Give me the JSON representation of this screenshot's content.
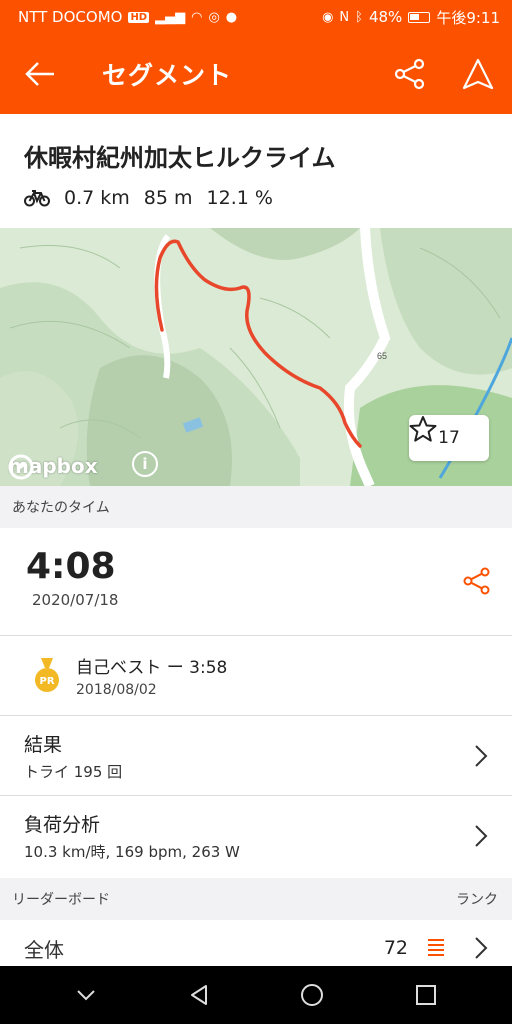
{
  "status_bar": {
    "carrier": "NTT DOCOMO",
    "carrier_badge": "HD",
    "battery": "48%",
    "time": "午後9:11"
  },
  "app_bar": {
    "title": "セグメント",
    "icons": [
      "back-arrow-icon",
      "share-icon",
      "navigate-icon"
    ]
  },
  "segment": {
    "name": "休暇村紀州加太ヒルクライム",
    "distance": "0.7 km",
    "elevation": "85 m",
    "grade": "12.1 %"
  },
  "map": {
    "provider": "mapbox",
    "road_label": "65",
    "star_count": "17",
    "route_color": "#e8472b"
  },
  "your_time": {
    "section_label": "あなたのタイム",
    "time": "4:08",
    "date": "2020/07/18"
  },
  "personal_best": {
    "badge": "PR",
    "label": "自己ベスト ー 3:58",
    "date": "2018/08/02"
  },
  "results": {
    "title": "結果",
    "subtitle": "トライ 195 回"
  },
  "effort_analysis": {
    "title": "負荷分析",
    "subtitle": "10.3 km/時, 169 bpm, 263 W"
  },
  "leaderboard": {
    "section_label": "リーダーボード",
    "rank_label": "ランク",
    "overall_label": "全体",
    "overall_rank": "72"
  },
  "colors": {
    "brand": "#fc5200",
    "gold": "#f2b925"
  }
}
